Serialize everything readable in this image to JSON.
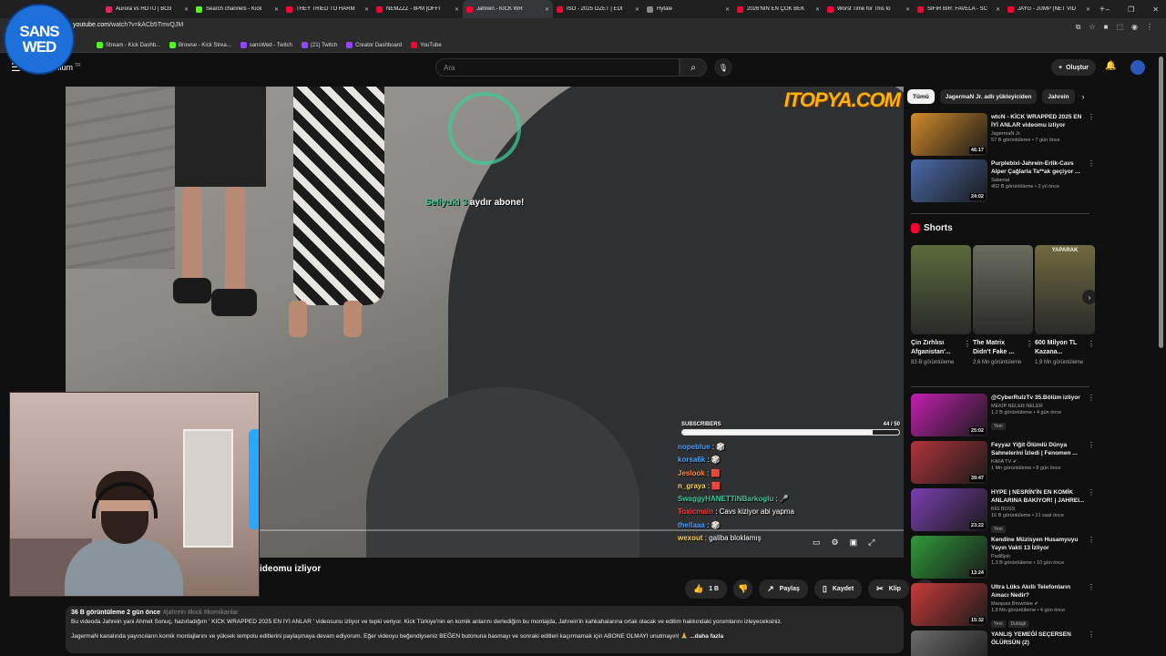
{
  "browser": {
    "tabs": [
      {
        "label": "Aurora vs HOTU | BO3",
        "color": "#e0245e"
      },
      {
        "label": "Search channels - Kick",
        "color": "#53fc18"
      },
      {
        "label": "THEY TRIED TO HARM",
        "color": "#ff0033"
      },
      {
        "label": "NEMZZZ - 8PM [OFFI",
        "color": "#ff0033"
      },
      {
        "label": "Jahrein - KİCK WR",
        "color": "#ff0033",
        "active": true
      },
      {
        "label": "İSO - 2025 ÖZET | EDİ",
        "color": "#ff0033"
      },
      {
        "label": "Hytale",
        "color": "#888888"
      },
      {
        "label": "2026'NIN EN ÇOK BEK",
        "color": "#ff0033"
      },
      {
        "label": "Worst Time for This to",
        "color": "#ff0033"
      },
      {
        "label": "SIFIR BİR: FAVELA - SC",
        "color": "#ff0033"
      },
      {
        "label": "JAYG - JUMP (NET VID",
        "color": "#ff0033"
      }
    ],
    "new_tab": "+",
    "window_controls": [
      "–",
      "❐",
      "✕"
    ],
    "url_host": "youtube.com",
    "url_path": "/watch?v=kACb5TmvQJM",
    "bookmarks": [
      {
        "label": "Stream - Kick Dashb...",
        "color": "#53fc18"
      },
      {
        "label": "Browse - Kick Strea...",
        "color": "#53fc18"
      },
      {
        "label": "sansWed - Twitch",
        "color": "#9146ff"
      },
      {
        "label": "(21) Twitch",
        "color": "#9146ff"
      },
      {
        "label": "Creator Dashboard",
        "color": "#9146ff"
      },
      {
        "label": "YouTube",
        "color": "#ff0033"
      }
    ]
  },
  "overlay_badge": {
    "line1": "SANS",
    "line2": "WED"
  },
  "header": {
    "logo_suffix": "mium",
    "logo_sup": "TR",
    "search_placeholder": "Ara",
    "create_label": "Oluştur"
  },
  "player": {
    "watermark": "ITOPYA.COM",
    "alert_user": "Seliyuki 3",
    "alert_rest": "aydır abone!",
    "subs_label": "SUBSCRIBERS",
    "subs_count": "44 / 50",
    "subs_progress": 0.88,
    "chat": [
      {
        "user": "nopeblue",
        "text": "🎲",
        "color": "#4aa3ff"
      },
      {
        "user": "korsa6k",
        "text": "🎲",
        "color": "#4aa3ff"
      },
      {
        "user": "Jeslook",
        "text": "🟥",
        "color": "#ff8a3d"
      },
      {
        "user": "n_graya",
        "text": "🟥",
        "color": "#ffd54a"
      },
      {
        "user": "SwaggyHANETTiNBarkoglu",
        "text": "🎤",
        "color": "#3ec99a"
      },
      {
        "user": "Toxicmain",
        "text": "Cavs kiziyor abi yapma",
        "color": "#ff3b3b"
      },
      {
        "user": "thellaaa",
        "text": "🎲",
        "color": "#4aa3ff"
      },
      {
        "user": "wexout",
        "text": "galiba bloklamış",
        "color": "#ffd54a"
      }
    ]
  },
  "video": {
    "title_visible": "ideomu izliyor",
    "like_count": "1 B",
    "share_label": "Paylaş",
    "save_label": "Kaydet",
    "clip_label": "Klip",
    "views_meta": "36 B görüntüleme  2 gün önce",
    "tags": "#jahrein #kick #komikanlar",
    "desc_line1": "Bu videoda Jahrein yani Ahmet Sonuç, hazırladığım ' KİCK WRAPPED 2025 EN İYİ ANLAR ' videosunu izliyor ve tepki veriyor. Kick Türkiye'nin en komik anlarını derlediğim bu montajda, Jahrein'in kahkahalarına ortak olacak ve editim hakkındaki yorumlarını izleyeceksiniz.",
    "desc_line2": "JagermaN kanalında yayıncıların komik montajlarını ve yüksek tempolu editlerini paylaşmaya devam ediyorum. Eğer videoyu beğendiyseniz BEĞEN butonuna basmayı ve sonraki editleri kaçırmamak için ABONE OLMAYI unutmayın! 🙏",
    "more_label": "...daha fazla"
  },
  "sidebar": {
    "chips": [
      "Tümü",
      "JagermaN Jr. adlı yükleyiciden",
      "Jahrein"
    ],
    "videos_top": [
      {
        "title": "wtcN - KİCK WRAPPED 2025 EN İYİ ANLAR videomu izliyor",
        "channel": "JagermaN Jr.",
        "stats": "57 B görüntüleme • 7 gün önce",
        "duration": "46:17",
        "thumb": "#d28a2a"
      },
      {
        "title": "Purplebixi-Jahrein-Erlik-Cavs Alper Çağlarla Ta**ak geçiyor ...",
        "channel": "Sataniat",
        "stats": "402 B görüntüleme • 2 yıl önce",
        "duration": "24:02",
        "thumb": "#4a6aa8"
      }
    ],
    "shorts_title": "Shorts",
    "shorts": [
      {
        "title": "Çin Zırhlısı Afganistan'...",
        "views": "83 B görüntüleme",
        "thumb": "#5b6b3c",
        "label": ""
      },
      {
        "title": "The Matrix Didn't Fake ...",
        "views": "2,6 Mn görüntüleme",
        "thumb": "#6a6c5e",
        "label": ""
      },
      {
        "title": "600 Milyon TL Kazana...",
        "views": "1,9 Mn görüntüleme",
        "thumb": "#6f6a3e",
        "label": "YAPARAK"
      }
    ],
    "videos_bottom": [
      {
        "title": "@CyberRulzTv  35.Bölüm izliyor",
        "channel": "MEKİP NELER NELER",
        "stats": "1,2 B görüntüleme • 4 gün önce",
        "duration": "25:02",
        "thumb": "#c21fb0",
        "badge": "Yeni"
      },
      {
        "title": "Feyyaz Yiğit Ölümlü Dünya Sahnelerini İzledi | Fenomen ...",
        "channel": "KAFA TV ✔",
        "stats": "1 Mn görüntüleme • 8 gün önce",
        "duration": "39:47",
        "thumb": "#b0343a"
      },
      {
        "title": "HYPE | NESRİN'İN EN KOMİK ANLARINA BAKIYOR! | JAHREI...",
        "channel": "BİG BOSS",
        "stats": "16 B görüntüleme • 21 saat önce",
        "duration": "23:22",
        "thumb": "#7b3fb0",
        "badge": "Yeni"
      },
      {
        "title": "Kendine Müzisyen Husamyuyu Yayın Vakti 13 İzliyor",
        "channel": "Padi5jsh",
        "stats": "1,3 B görüntüleme • 10 gün önce",
        "duration": "13:24",
        "thumb": "#2f9a3a"
      },
      {
        "title": "Ultra Lüks Akıllı Telefonların Amacı Nedir?",
        "channel": "Marques Brownlee ✔",
        "stats": "1,8 Mn görüntüleme • 4 gün önce",
        "duration": "15:32",
        "thumb": "#c83a3a",
        "badge": "Yeni",
        "badge2": "Dublajlı"
      },
      {
        "title": "YANLIŞ YEMEĞİ SEÇERSEN ÖLÜRSÜN (2)",
        "channel": "",
        "stats": "",
        "duration": "",
        "thumb": "#6b6b6b"
      }
    ]
  }
}
